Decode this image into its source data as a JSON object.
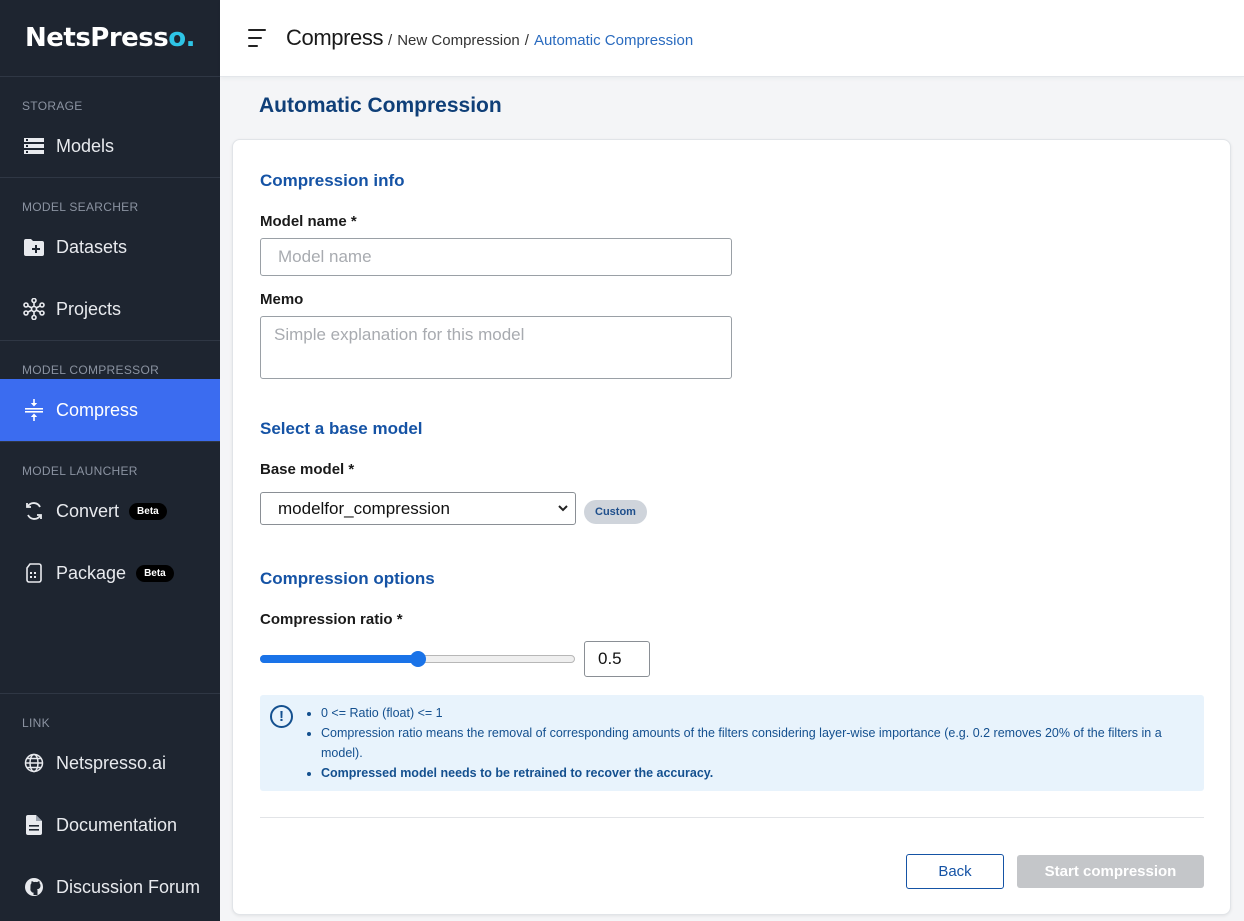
{
  "brand": {
    "name_main": "NetsPress",
    "name_o": "o",
    "dot": "."
  },
  "sidebar": {
    "sections": [
      {
        "title": "STORAGE",
        "items": [
          {
            "label": "Models",
            "icon": "list-icon"
          }
        ]
      },
      {
        "title": "MODEL SEARCHER",
        "items": [
          {
            "label": "Datasets",
            "icon": "folder-plus-icon"
          },
          {
            "label": "Projects",
            "icon": "network-icon"
          }
        ]
      },
      {
        "title": "MODEL COMPRESSOR",
        "items": [
          {
            "label": "Compress",
            "icon": "compress-icon",
            "active": true
          }
        ]
      },
      {
        "title": "MODEL LAUNCHER",
        "items": [
          {
            "label": "Convert",
            "icon": "sync-icon",
            "badge": "Beta"
          },
          {
            "label": "Package",
            "icon": "package-icon",
            "badge": "Beta"
          }
        ]
      },
      {
        "title": "LINK",
        "items": [
          {
            "label": "Netspresso.ai",
            "icon": "globe-icon"
          },
          {
            "label": "Documentation",
            "icon": "document-icon"
          },
          {
            "label": "Discussion Forum",
            "icon": "github-icon"
          }
        ]
      }
    ]
  },
  "header": {
    "crumb_main": "Compress",
    "crumb_sep": "/",
    "crumb_mid": "New Compression",
    "crumb_current": "Automatic Compression"
  },
  "page": {
    "title": "Automatic Compression"
  },
  "form": {
    "info_heading": "Compression info",
    "model_name_label": "Model name *",
    "model_name_placeholder": "Model name",
    "memo_label": "Memo",
    "memo_placeholder": "Simple explanation for this model",
    "base_heading": "Select a base model",
    "base_label": "Base model *",
    "base_value": "modelfor_compression",
    "base_badge": "Custom",
    "options_heading": "Compression options",
    "ratio_label": "Compression ratio *",
    "ratio_value": "0.5",
    "ratio_fraction": 0.5,
    "notes": [
      "0 <= Ratio (float) <= 1",
      "Compression ratio means the removal of corresponding amounts of the filters considering layer-wise importance (e.g. 0.2 removes 20% of the filters in a model).",
      "Compressed model needs to be retrained to recover the accuracy."
    ],
    "back_label": "Back",
    "start_label": "Start compression"
  },
  "colors": {
    "accent": "#3b6cf0",
    "heading": "#1553a5",
    "sidebar_bg": "#1e2530"
  }
}
